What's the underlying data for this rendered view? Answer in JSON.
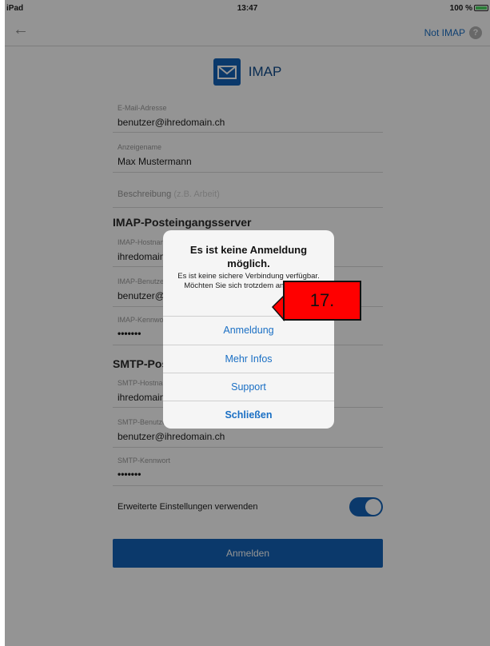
{
  "status": {
    "device": "iPad",
    "time": "13:47",
    "battery": "100 %"
  },
  "nav": {
    "back_symbol": "←",
    "not_imap": "Not IMAP",
    "help_symbol": "?"
  },
  "header": {
    "title": "IMAP"
  },
  "form": {
    "email_label": "E-Mail-Adresse",
    "email_value": "benutzer@ihredomain.ch",
    "display_name_label": "Anzeigename",
    "display_name_value": "Max Mustermann",
    "description_placeholder": "Beschreibung",
    "description_hint": "(z.B. Arbeit)",
    "imap_section": "IMAP-Posteingangsserver",
    "imap_host_label": "IMAP-Hostname",
    "imap_host_value": "ihredomain.ch",
    "imap_user_label": "IMAP-Benutzername",
    "imap_user_value": "benutzer@ihredomain.ch",
    "imap_pass_label": "IMAP-Kennwort",
    "imap_pass_value": "•••••••",
    "smtp_section": "SMTP-Postausgangsserver",
    "smtp_host_label": "SMTP-Hostname",
    "smtp_host_value": "ihredomain.ch",
    "smtp_user_label": "SMTP-Benutzername",
    "smtp_user_value": "benutzer@ihredomain.ch",
    "smtp_pass_label": "SMTP-Kennwort",
    "smtp_pass_value": "•••••••",
    "advanced_label": "Erweiterte Einstellungen verwenden",
    "advanced_enabled": true,
    "submit_label": "Anmelden"
  },
  "alert": {
    "title": "Es ist keine Anmeldung möglich.",
    "message": "Es ist keine sichere Verbindung verfügbar. Möchten Sie sich trotzdem anmelden?",
    "buttons": [
      "Anmeldung",
      "Mehr Infos",
      "Support",
      "Schließen"
    ]
  },
  "callout": {
    "label": "17."
  },
  "colors": {
    "accent": "#1363b8",
    "link": "#1a6fc4",
    "callout": "#ff0000"
  }
}
